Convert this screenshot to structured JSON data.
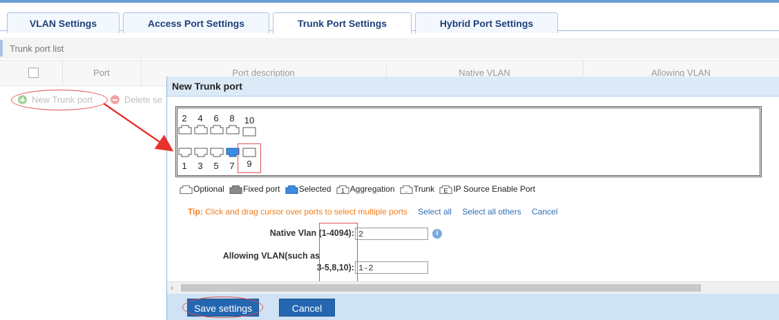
{
  "tabs": [
    {
      "label": "VLAN Settings",
      "active": false
    },
    {
      "label": "Access Port Settings",
      "active": false
    },
    {
      "label": "Trunk Port Settings",
      "active": true
    },
    {
      "label": "Hybrid Port Settings",
      "active": false
    }
  ],
  "section": {
    "title": "Trunk port list"
  },
  "table": {
    "columns": [
      "Port",
      "Port description",
      "Native VLAN",
      "Allowing VLAN"
    ]
  },
  "actions": {
    "new_label": "New Trunk port",
    "delete_label": "Delete se"
  },
  "dialog": {
    "title": "New Trunk port",
    "ports_top": [
      "2",
      "4",
      "6",
      "8",
      "10"
    ],
    "ports_bottom": [
      "1",
      "3",
      "5",
      "7",
      "9"
    ],
    "selected_port": "7",
    "legend": [
      "Optional",
      "Fixed port",
      "Selected",
      "Aggregation",
      "Trunk",
      "IP Source Enable Port"
    ],
    "legend_icon_glyphs": {
      "aggregation": "1",
      "trunk": "...",
      "ipsource": "E"
    },
    "tip": {
      "label": "Tip:",
      "text": "Click and drag cursor over ports to select multiple ports",
      "select_all": "Select all",
      "select_all_others": "Select all others",
      "cancel": "Cancel"
    },
    "native_vlan": {
      "label": "Native Vlan (1-4094):",
      "value": "2"
    },
    "allowing_vlan": {
      "label_line1": "Allowing VLAN(such as",
      "label_line2": "3-5,8,10):",
      "value": "1-2"
    },
    "save_label": "Save settings",
    "cancel_label": "Cancel"
  },
  "colors": {
    "tab_text": "#1e3f78",
    "tip": "#f07c1a",
    "link": "#2f6db5",
    "button": "#2466b0",
    "selected_port": "#3a8de0",
    "annotation": "#e05050"
  }
}
